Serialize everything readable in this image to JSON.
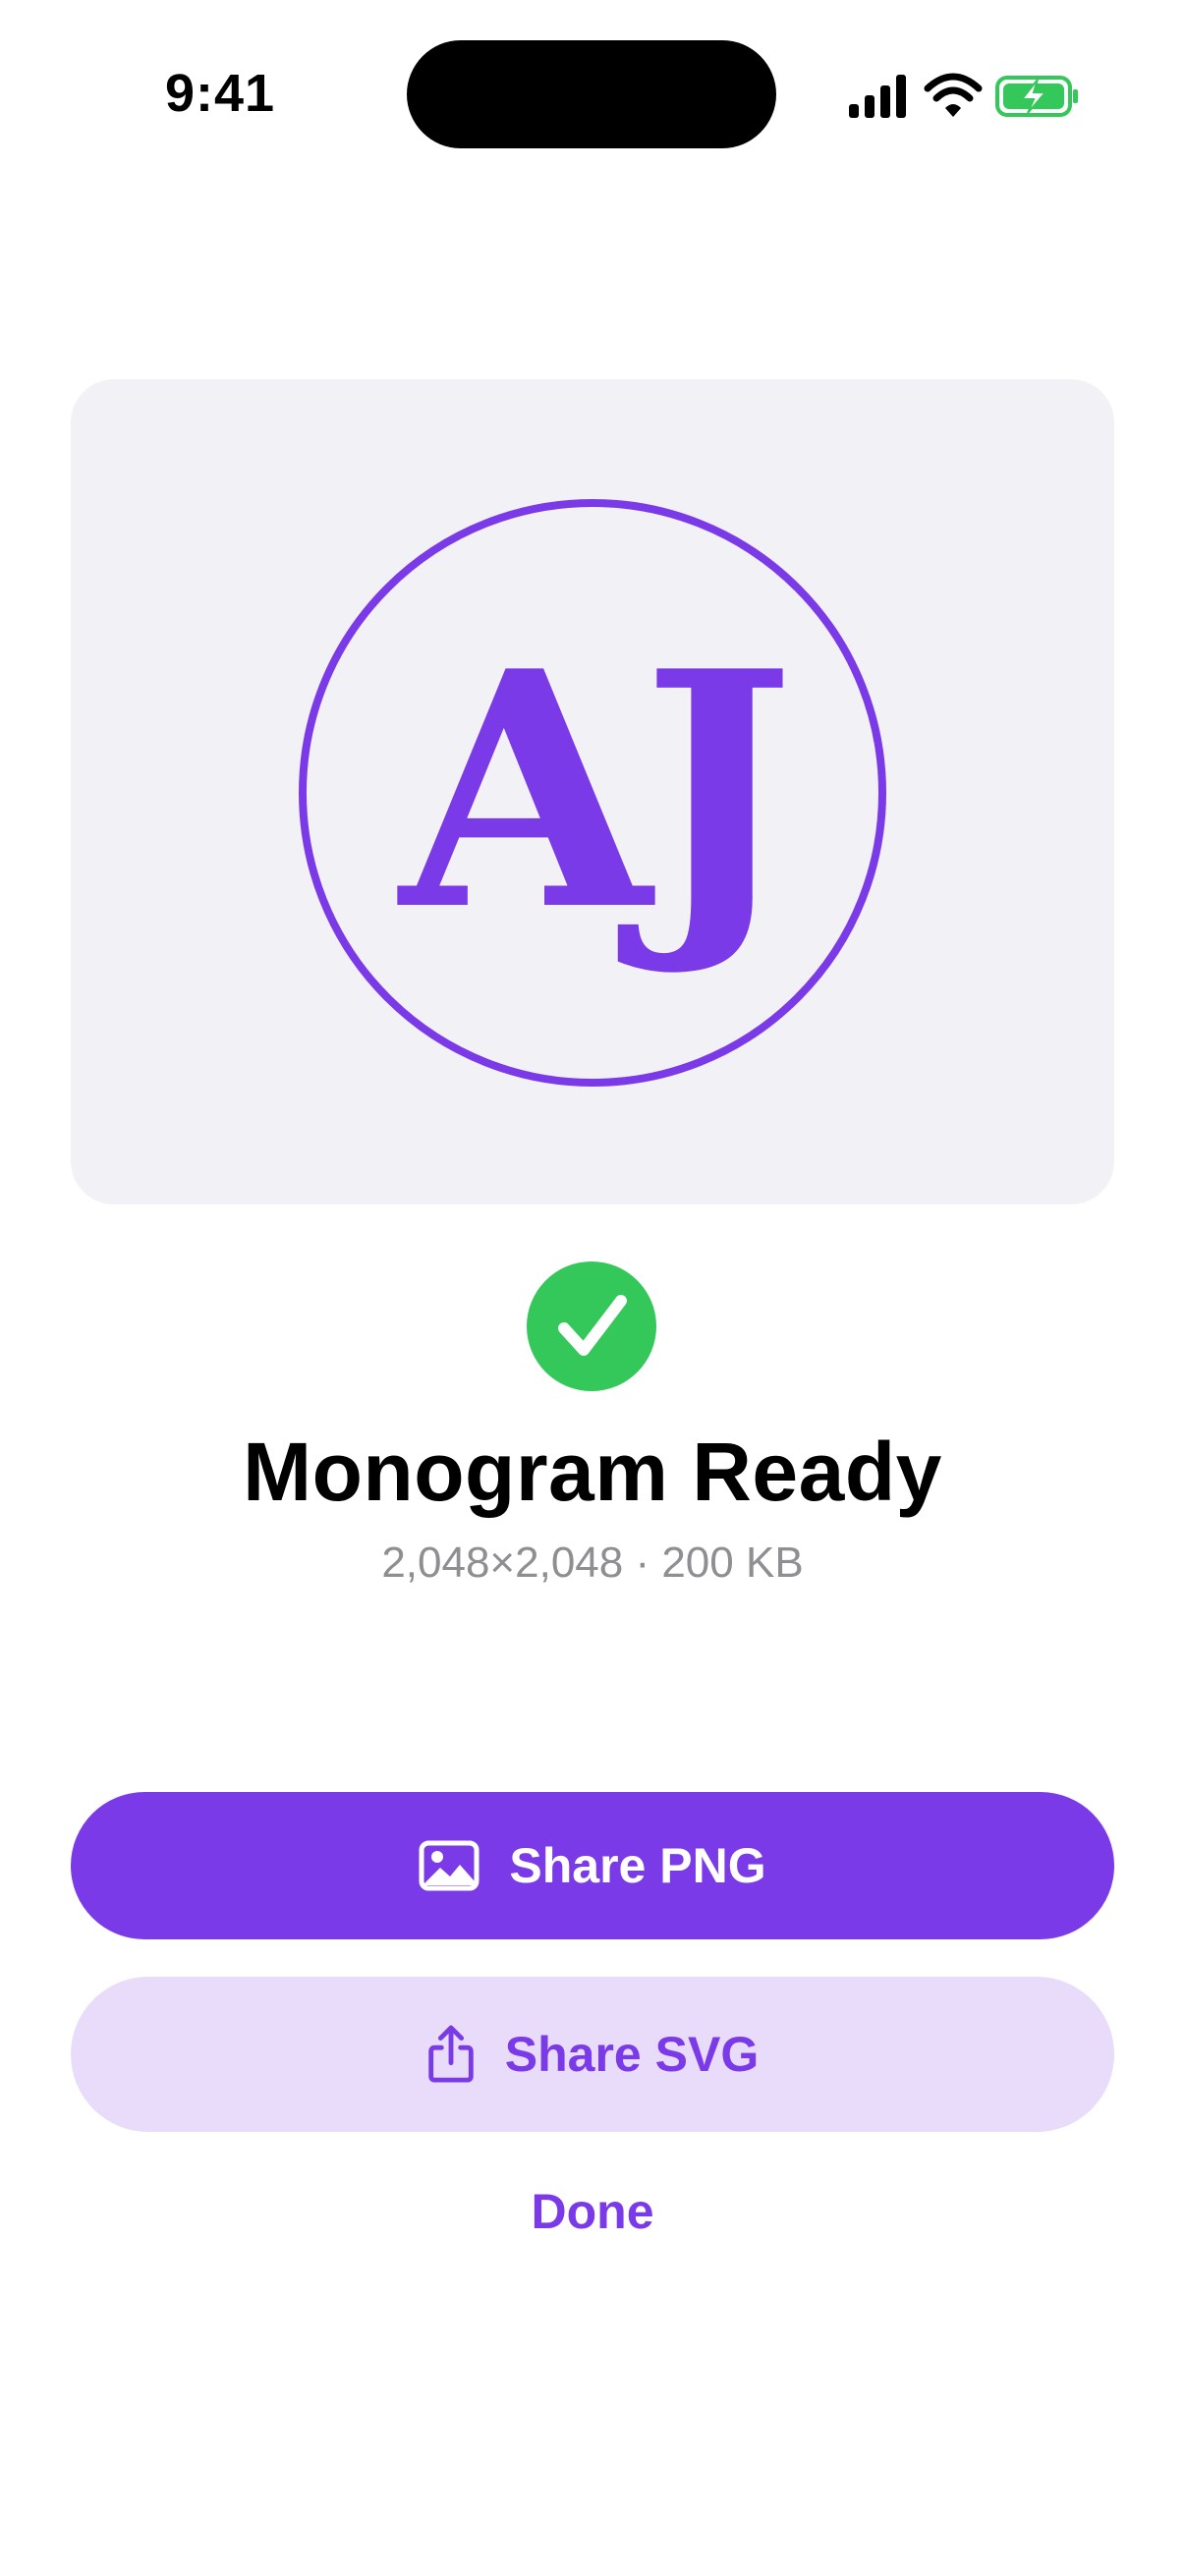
{
  "status_bar": {
    "time": "9:41",
    "icons": [
      "cellular-signal-icon",
      "wifi-icon",
      "battery-charging-icon"
    ]
  },
  "preview": {
    "monogram": "AJ",
    "accent_color": "#7b3ae8",
    "background_color": "#f2f1f6"
  },
  "result": {
    "status_icon": "checkmark-icon",
    "status_color": "#34c759",
    "title": "Monogram Ready",
    "details": "2,048×2,048 · 200 KB"
  },
  "actions": {
    "share_png": {
      "label": "Share PNG",
      "icon": "image-icon"
    },
    "share_svg": {
      "label": "Share SVG",
      "icon": "share-icon"
    },
    "done": "Done"
  }
}
